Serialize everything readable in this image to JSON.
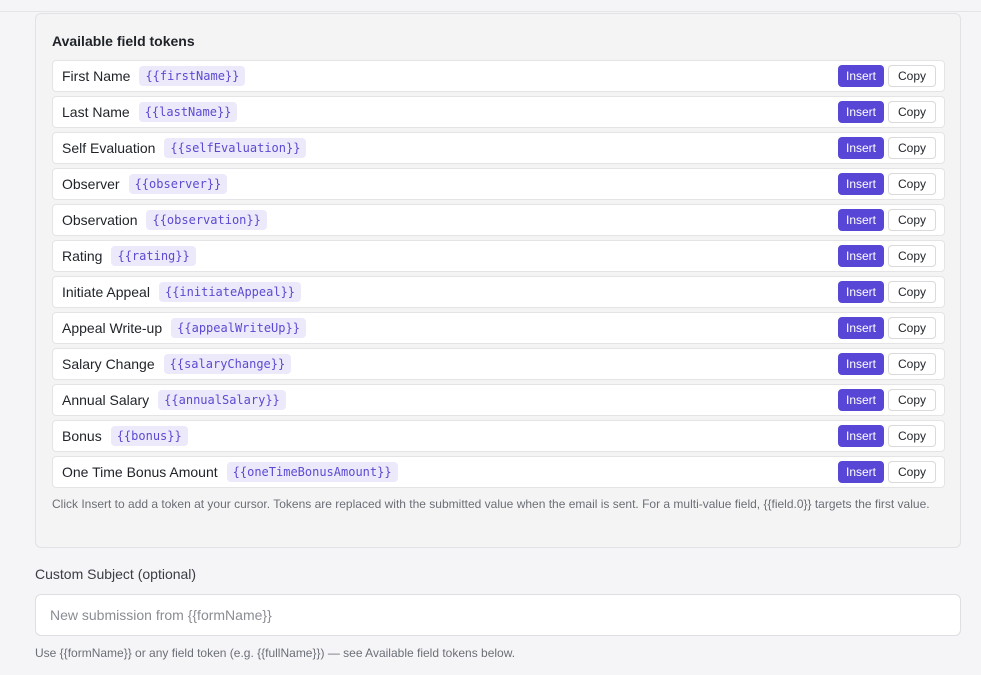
{
  "tokens_panel": {
    "title": "Available field tokens",
    "insert_label": "Insert",
    "copy_label": "Copy",
    "help_text": "Click Insert to add a token at your cursor. Tokens are replaced with the submitted value when the email is sent. For a multi-value field, {{field.0}} targets the first value.",
    "tokens": [
      {
        "label": "First Name",
        "token": "{{firstName}}"
      },
      {
        "label": "Last Name",
        "token": "{{lastName}}"
      },
      {
        "label": "Self Evaluation",
        "token": "{{selfEvaluation}}"
      },
      {
        "label": "Observer",
        "token": "{{observer}}"
      },
      {
        "label": "Observation",
        "token": "{{observation}}"
      },
      {
        "label": "Rating",
        "token": "{{rating}}"
      },
      {
        "label": "Initiate Appeal",
        "token": "{{initiateAppeal}}"
      },
      {
        "label": "Appeal Write-up",
        "token": "{{appealWriteUp}}"
      },
      {
        "label": "Salary Change",
        "token": "{{salaryChange}}"
      },
      {
        "label": "Annual Salary",
        "token": "{{annualSalary}}"
      },
      {
        "label": "Bonus",
        "token": "{{bonus}}"
      },
      {
        "label": "One Time Bonus Amount",
        "token": "{{oneTimeBonusAmount}}"
      }
    ]
  },
  "custom_subject": {
    "label": "Custom Subject (optional)",
    "value": "",
    "placeholder": "New submission from {{formName}}",
    "help_text": "Use {{formName}} or any field token (e.g. {{fullName}}) — see Available field tokens below."
  },
  "colors": {
    "accent": "#5847d6",
    "token_chip_bg": "#ece9fb",
    "token_chip_text": "#5b4ad1"
  }
}
